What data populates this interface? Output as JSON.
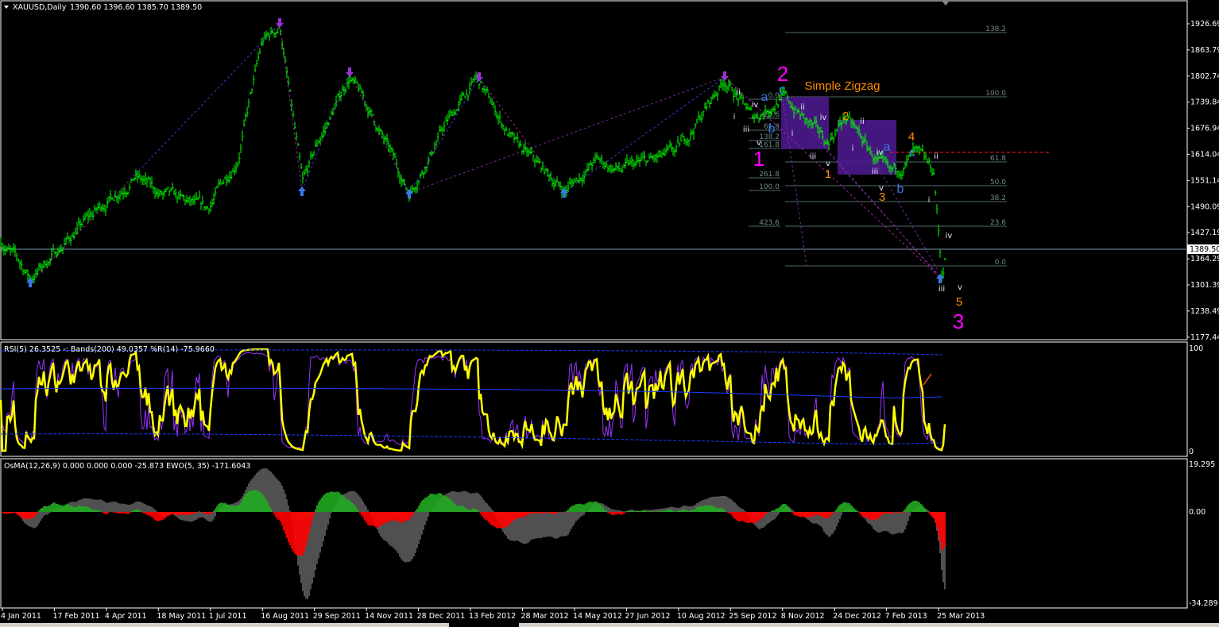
{
  "window": {
    "symbol_title": "XAUUSD,Daily",
    "ohlc": "1390.60 1396.60 1385.70 1389.50",
    "current_price": "1389.50"
  },
  "price_axis": [
    "1926.69",
    "1863.79",
    "1802.74",
    "1739.84",
    "1676.94",
    "1614.04",
    "1551.14",
    "1490.09",
    "1427.19",
    "1364.29",
    "1301.39",
    "1238.49",
    "1177.44"
  ],
  "time_axis": [
    "4 Jan 2011",
    "17 Feb 2011",
    "4 Apr 2011",
    "18 May 2011",
    "1 Jul 2011",
    "16 Aug 2011",
    "29 Sep 2011",
    "14 Nov 2011",
    "28 Dec 2011",
    "13 Feb 2012",
    "28 Mar 2012",
    "14 May 2012",
    "27 Jun 2012",
    "10 Aug 2012",
    "25 Sep 2012",
    "8 Nov 2012",
    "24 Dec 2012",
    "7 Feb 2013",
    "25 Mar 2013"
  ],
  "rsi_panel": {
    "legend": "RSI(5) 26.3525  -: Bands(200) 49.0357  %R(14) -75.9660",
    "axis_top": "100",
    "axis_bottom": "0"
  },
  "osma_panel": {
    "legend": "OsMA(12,26,9) 0.000 0.000 0.000 -25.873  EWO(5, 35) -171.6043",
    "axis": [
      "19.295",
      "0.00",
      "-34.289"
    ]
  },
  "fibonacci": {
    "right": [
      "138.2",
      "100.0",
      "61.8",
      "50.0",
      "38.2",
      "23.6",
      "0.0"
    ],
    "left": [
      "0.0",
      "23.6",
      "61.8",
      "100.0",
      "138.2",
      "161.8",
      "261.8",
      "423.6"
    ]
  },
  "annotation_title": "Simple Zigzag",
  "waves": {
    "primary": [
      "2",
      "1",
      "3"
    ],
    "abc": [
      "c",
      "a",
      "b",
      "a",
      "c",
      "b"
    ],
    "intermediate": [
      "2",
      "4",
      "1",
      "3",
      "5"
    ],
    "minor": [
      "ii",
      "iv",
      "i",
      "iii",
      "v",
      "ii",
      "i",
      "iv",
      "iii",
      "v",
      "ii",
      "i",
      "iv",
      "iii",
      "v",
      "ii",
      "i",
      "iv",
      "iii",
      "v"
    ]
  },
  "colors": {
    "bars": "#00ff00",
    "primary_wave": "#ff00ff",
    "abc_wave": "#3a78e6",
    "intermediate_wave": "#ff8c00",
    "rsi": "#ffff00",
    "percent_r": "#9933ff",
    "bands": "#1e3cff",
    "osma_up": "#22aa22",
    "osma_down": "#ff0000",
    "ewo": "#a0a0a0",
    "zone": "#4b1a8c"
  },
  "chart_data": {
    "type": "candlestick-bars",
    "symbol": "XAUUSD",
    "timeframe": "Daily",
    "last_bar": {
      "open": 1390.6,
      "high": 1396.6,
      "low": 1385.7,
      "close": 1389.5
    },
    "ylim": [
      1177.44,
      1926.69
    ],
    "swing_points": [
      {
        "date": "2011-01-03",
        "price": 1414
      },
      {
        "date": "2011-01-28",
        "price": 1319
      },
      {
        "date": "2011-03-11",
        "price": 1440
      },
      {
        "date": "2011-04-28",
        "price": 1566
      },
      {
        "date": "2011-05-18",
        "price": 1520
      },
      {
        "date": "2011-06-28",
        "price": 1478
      },
      {
        "date": "2011-07-25",
        "price": 1610
      },
      {
        "date": "2011-08-16",
        "price": 1880
      },
      {
        "date": "2011-08-31",
        "price": 1921
      },
      {
        "date": "2011-09-19",
        "price": 1535
      },
      {
        "date": "2011-10-02",
        "price": 1640
      },
      {
        "date": "2011-10-30",
        "price": 1802
      },
      {
        "date": "2011-11-20",
        "price": 1700
      },
      {
        "date": "2011-12-20",
        "price": 1523
      },
      {
        "date": "2012-01-20",
        "price": 1680
      },
      {
        "date": "2012-02-18",
        "price": 1794
      },
      {
        "date": "2012-03-23",
        "price": 1633
      },
      {
        "date": "2012-05-05",
        "price": 1529
      },
      {
        "date": "2012-06-01",
        "price": 1600
      },
      {
        "date": "2012-06-22",
        "price": 1576
      },
      {
        "date": "2012-08-08",
        "price": 1614
      },
      {
        "date": "2012-09-20",
        "price": 1796
      },
      {
        "date": "2012-10-14",
        "price": 1700
      },
      {
        "date": "2012-11-08",
        "price": 1754
      },
      {
        "date": "2012-12-17",
        "price": 1640
      },
      {
        "date": "2013-01-02",
        "price": 1705
      },
      {
        "date": "2013-02-10",
        "price": 1555
      },
      {
        "date": "2013-03-03",
        "price": 1614
      },
      {
        "date": "2013-03-21",
        "price": 1566
      },
      {
        "date": "2013-03-28",
        "price": 1321
      },
      {
        "date": "2013-04-01",
        "price": 1389.5
      }
    ],
    "tick_dates": [
      "2011-01-04",
      "2011-02-17",
      "2011-04-04",
      "2011-05-18",
      "2011-07-01",
      "2011-08-16",
      "2011-09-29",
      "2011-11-14",
      "2011-12-28",
      "2012-02-13",
      "2012-03-28",
      "2012-05-14",
      "2012-06-27",
      "2012-08-10",
      "2012-09-25",
      "2012-11-08",
      "2012-12-24",
      "2013-02-07",
      "2013-03-25"
    ],
    "indicators": {
      "rsi5": 26.3525,
      "bands200": 49.0357,
      "williams_r14": -75.966,
      "osma": -25.873,
      "ewo": -171.6043
    }
  }
}
